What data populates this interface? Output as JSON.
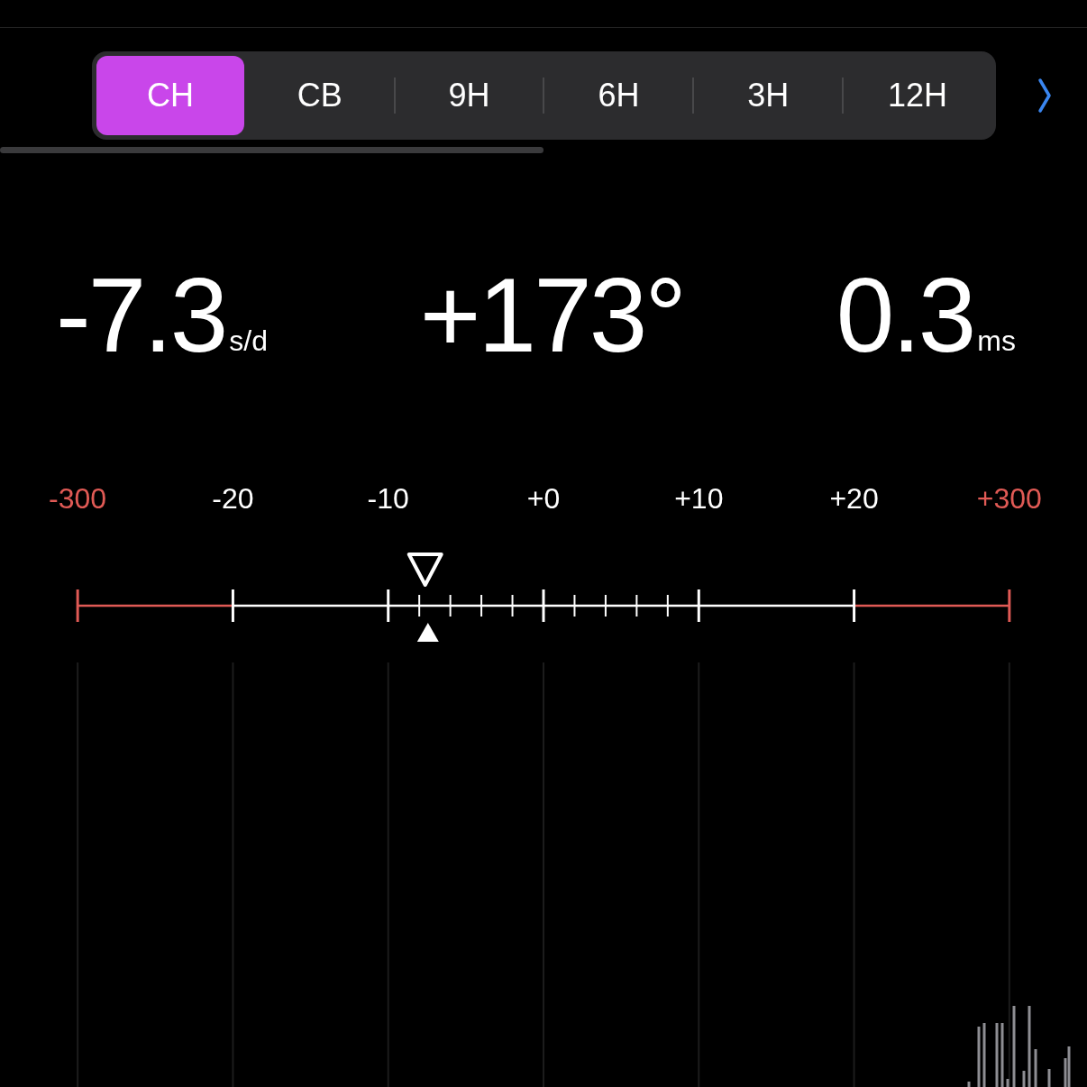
{
  "tabs": [
    {
      "label": "CH",
      "selected": true
    },
    {
      "label": "CB",
      "selected": false
    },
    {
      "label": "9H",
      "selected": false
    },
    {
      "label": "6H",
      "selected": false
    },
    {
      "label": "3H",
      "selected": false
    },
    {
      "label": "12H",
      "selected": false
    }
  ],
  "readings": [
    {
      "value": "-7.3",
      "unit": "s/d"
    },
    {
      "value": "+173°"
    },
    {
      "value": "0.3",
      "unit": "ms"
    }
  ],
  "scale": {
    "labels": [
      {
        "text": "-300",
        "kind": "limit"
      },
      {
        "text": "-20",
        "kind": "normal"
      },
      {
        "text": "-10",
        "kind": "normal"
      },
      {
        "text": "+0",
        "kind": "normal"
      },
      {
        "text": "+10",
        "kind": "normal"
      },
      {
        "text": "+20",
        "kind": "normal"
      },
      {
        "text": "+300",
        "kind": "limit"
      }
    ],
    "markers": [
      {
        "kind": "outline",
        "level": 0.373
      },
      {
        "kind": "solid",
        "level": 0.376
      }
    ]
  }
}
